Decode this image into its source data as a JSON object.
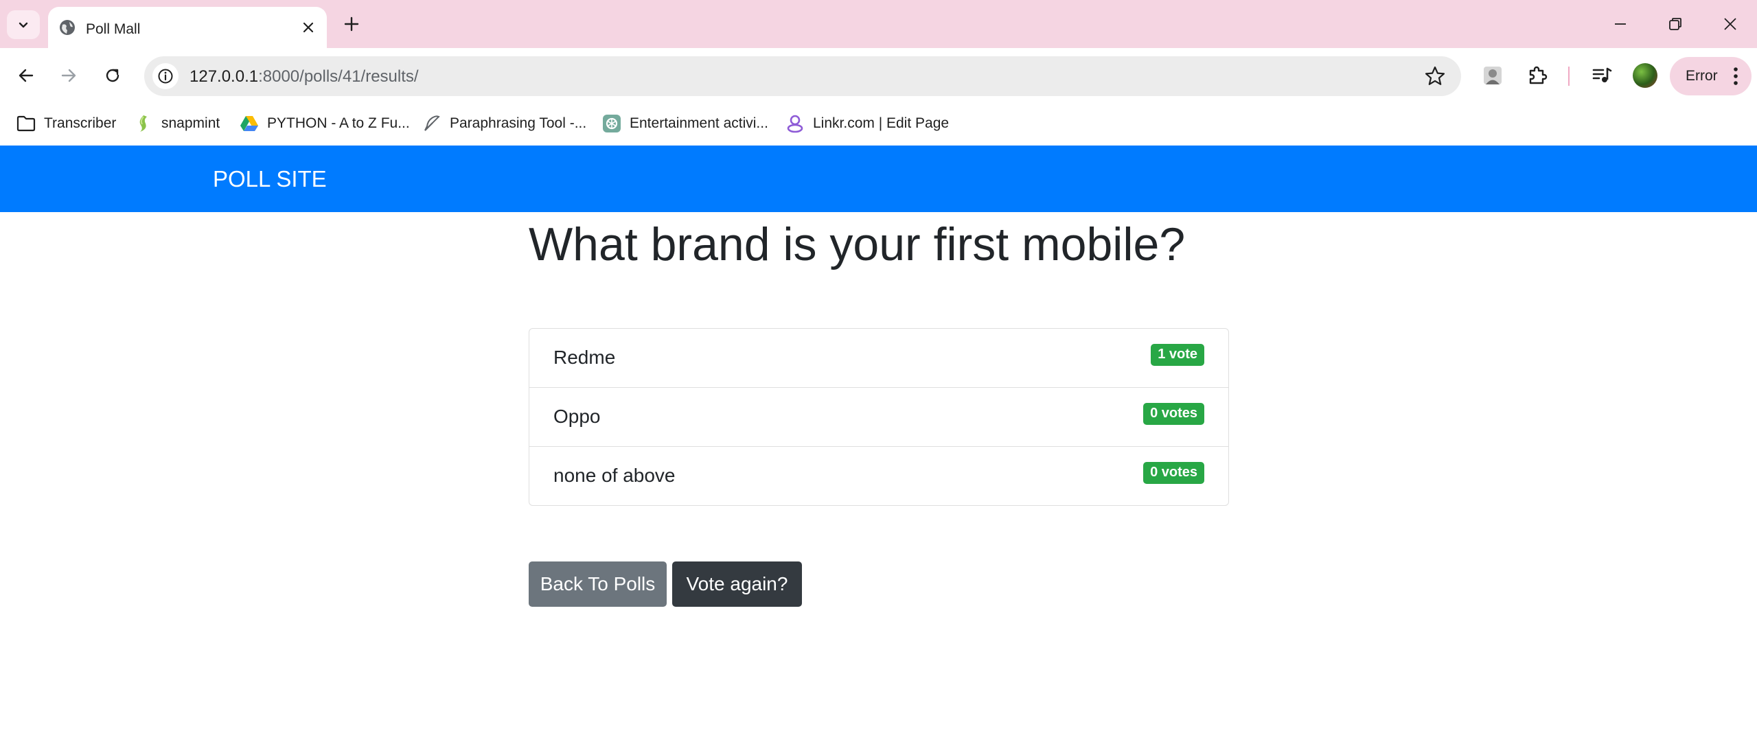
{
  "browser": {
    "tab_title": "Poll Mall",
    "url_host": "127.0.0.1",
    "url_path": ":8000/polls/41/results/",
    "profile_status": "Error",
    "bookmarks": [
      {
        "label": "Transcriber",
        "icon": "folder-icon"
      },
      {
        "label": "snapmint",
        "icon": "snapmint-icon"
      },
      {
        "label": "PYTHON - A to Z Fu...",
        "icon": "google-drive-icon"
      },
      {
        "label": "Paraphrasing Tool -...",
        "icon": "feather-icon"
      },
      {
        "label": "Entertainment activi...",
        "icon": "chatgpt-icon"
      },
      {
        "label": "Linkr.com | Edit Page",
        "icon": "linkr-icon"
      }
    ]
  },
  "navbar": {
    "brand": "POLL SITE",
    "color": "#007bff"
  },
  "poll": {
    "question": "What brand is your first mobile?",
    "choices": [
      {
        "label": "Redme",
        "votes": "1 vote"
      },
      {
        "label": "Oppo",
        "votes": "0 votes"
      },
      {
        "label": "none of above",
        "votes": "0 votes"
      }
    ]
  },
  "actions": {
    "back_label": "Back To Polls",
    "vote_again_label": "Vote again?"
  },
  "colors": {
    "badge": "#28a745",
    "back_button": "#6c757d",
    "vote_button": "#343a40",
    "tabstrip": "#f5d5e2"
  }
}
